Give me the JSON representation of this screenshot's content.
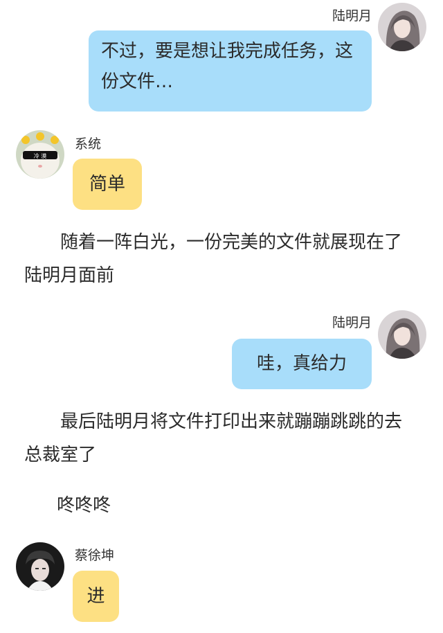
{
  "colors": {
    "user_bubble": "#a8ddfa",
    "other_bubble": "#fde083",
    "background": "#ffffff"
  },
  "messages": [
    {
      "sender": "陆明月",
      "side": "right",
      "text": "不过，要是想让我完成任务，这份文件…",
      "avatar": "girl-avatar"
    },
    {
      "sender": "系统",
      "side": "left",
      "text": "简单",
      "avatar": "cat-sunglasses-avatar"
    },
    {
      "type": "narration",
      "text": "随着一阵白光，一份完美的文件就展现在了陆明月面前"
    },
    {
      "sender": "陆明月",
      "side": "right",
      "text": "哇，真给力",
      "avatar": "girl-avatar"
    },
    {
      "type": "narration",
      "text": "最后陆明月将文件打印出来就蹦蹦跳跳的去总裁室了"
    },
    {
      "type": "narration",
      "text": "咚咚咚"
    },
    {
      "sender": "蔡徐坤",
      "side": "left",
      "text": "进",
      "avatar": "boy-avatar"
    }
  ],
  "cat_glasses_text": "冷 漠"
}
